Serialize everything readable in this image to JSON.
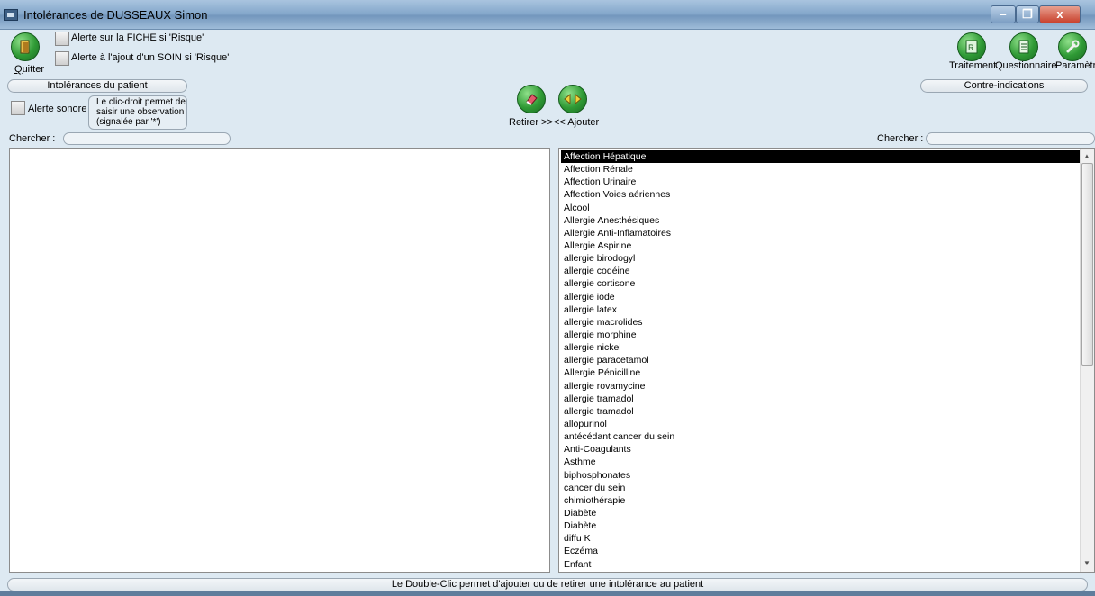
{
  "window": {
    "title": "Intolérances de DUSSEAUX Simon",
    "controls": {
      "minimize": "–",
      "maximize": "❐",
      "close": "x"
    }
  },
  "toolbar": {
    "quit": {
      "label": "Quitter",
      "accel": "Q",
      "icon": "door-exit-icon"
    },
    "alert_fiche": "Alerte sur la FICHE si 'Risque'",
    "alert_soin": "Alerte à l'ajout d'un SOIN si 'Risque'",
    "traitement": {
      "label": "Traitement",
      "icon": "prescription-icon"
    },
    "questionnaire": {
      "label": "Questionnaire",
      "icon": "document-icon"
    },
    "parametres": {
      "label": "Paramètres",
      "icon": "wrench-icon"
    }
  },
  "left_panel": {
    "header": "Intolérances du patient",
    "alert_sound": "Alerte sonore",
    "hint_line1": "Le clic-droit permet de",
    "hint_line2": "saisir une observation",
    "hint_line3": "(signalée par '*')",
    "search_label": "Chercher :",
    "search_value": "",
    "items": []
  },
  "middle": {
    "retirer": {
      "label": "Retirer >>",
      "icon": "eraser-icon"
    },
    "ajouter": {
      "label": "<< Ajouter",
      "icon": "swap-arrows-icon"
    }
  },
  "right_panel": {
    "header": "Contre-indications",
    "search_label": "Chercher :",
    "search_value": "",
    "selected_index": 0,
    "items": [
      "Affection Hépatique",
      "Affection Rénale",
      "Affection Urinaire",
      "Affection Voies aériennes",
      "Alcool",
      "Allergie Anesthésiques",
      "Allergie Anti-Inflamatoires",
      "Allergie Aspirine",
      "allergie birodogyl",
      "allergie codéine",
      "allergie cortisone",
      "allergie iode",
      "allergie latex",
      "allergie macrolides",
      "allergie morphine",
      "allergie nickel",
      "allergie paracetamol",
      "Allergie Pénicilline",
      "allergie rovamycine",
      "allergie tramadol",
      "allergie tramadol",
      "allopurinol",
      "antécédant cancer du sein",
      "Anti-Coagulants",
      "Asthme",
      "biphosphonates",
      "cancer du sein",
      "chimiothérapie",
      "Diabète",
      "Diabète",
      "diffu K",
      "Eczéma",
      "Enfant"
    ]
  },
  "status": "Le Double-Clic permet d'ajouter ou de retirer une intolérance au patient",
  "colors": {
    "accent_green": "#2f9a35",
    "background": "#dde9f2",
    "selection": "#000000"
  }
}
